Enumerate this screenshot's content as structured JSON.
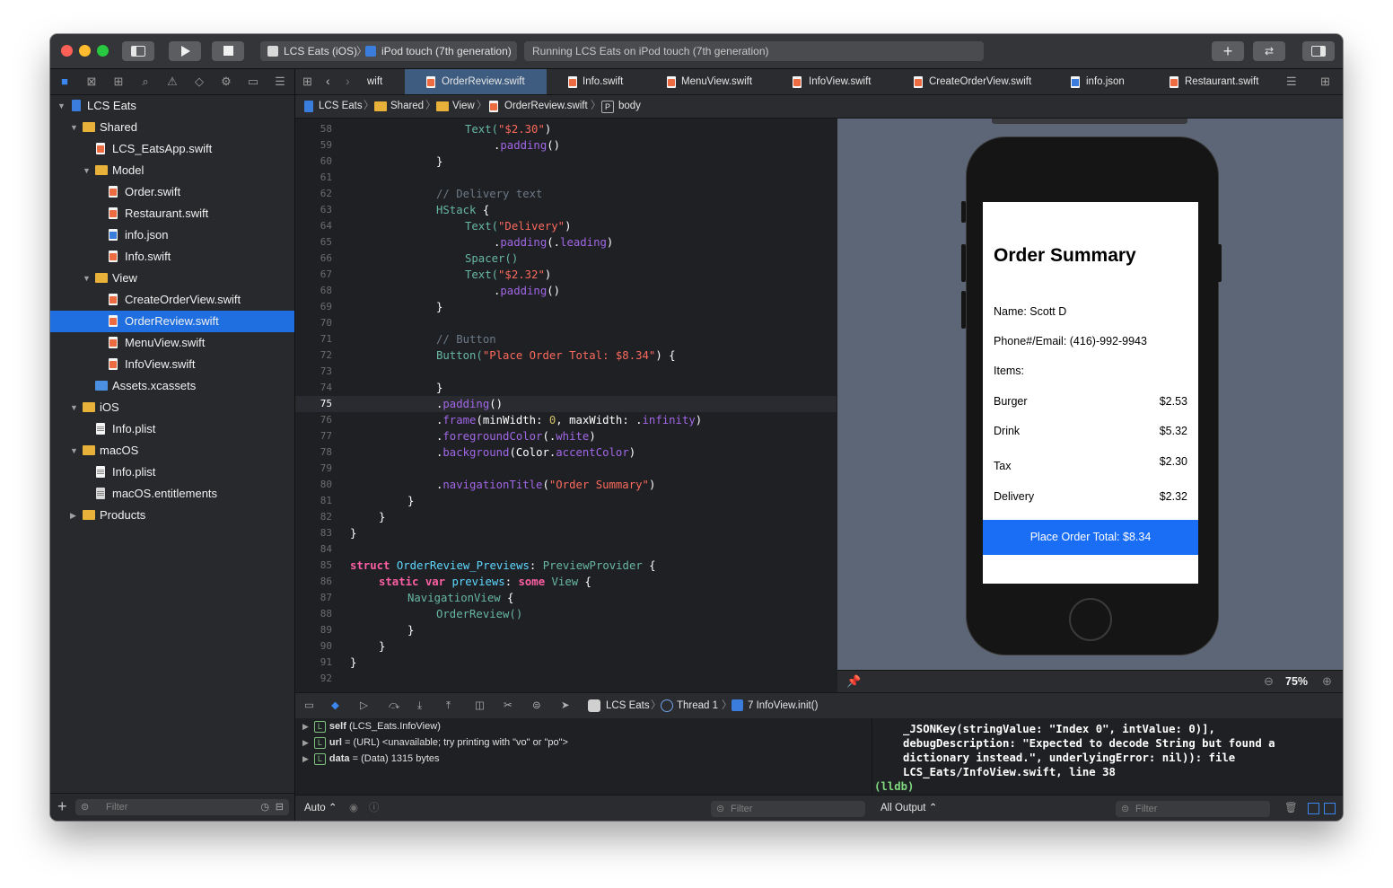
{
  "toolbar": {
    "scheme": "LCS Eats (iOS)",
    "destination": "iPod touch (7th generation)",
    "activity": "Running LCS Eats on iPod touch (7th generation)"
  },
  "navigator": {
    "items": [
      {
        "label": "LCS Eats"
      },
      {
        "label": "Shared"
      },
      {
        "label": "LCS_EatsApp.swift"
      },
      {
        "label": "Model"
      },
      {
        "label": "Order.swift"
      },
      {
        "label": "Restaurant.swift"
      },
      {
        "label": "info.json"
      },
      {
        "label": "Info.swift"
      },
      {
        "label": "View"
      },
      {
        "label": "CreateOrderView.swift"
      },
      {
        "label": "OrderReview.swift"
      },
      {
        "label": "MenuView.swift"
      },
      {
        "label": "InfoView.swift"
      },
      {
        "label": "Assets.xcassets"
      },
      {
        "label": "iOS"
      },
      {
        "label": "Info.plist"
      },
      {
        "label": "macOS"
      },
      {
        "label": "Info.plist"
      },
      {
        "label": "macOS.entitlements"
      },
      {
        "label": "Products"
      }
    ],
    "filter_placeholder": "Filter"
  },
  "tabs": [
    {
      "label": "wift"
    },
    {
      "label": "OrderReview.swift"
    },
    {
      "label": "Info.swift"
    },
    {
      "label": "MenuView.swift"
    },
    {
      "label": "InfoView.swift"
    },
    {
      "label": "CreateOrderView.swift"
    },
    {
      "label": "info.json"
    },
    {
      "label": "Restaurant.swift"
    }
  ],
  "jumpbar": [
    "LCS Eats",
    "Shared",
    "View",
    "OrderReview.swift",
    "body"
  ],
  "code": {
    "line_numbers": [
      "58",
      "59",
      "60",
      "61",
      "62",
      "63",
      "64",
      "65",
      "66",
      "67",
      "68",
      "69",
      "70",
      "71",
      "72",
      "73",
      "74",
      "75",
      "76",
      "77",
      "78",
      "79",
      "80",
      "81",
      "82",
      "83",
      "84",
      "85",
      "86",
      "87",
      "88",
      "89",
      "90",
      "91",
      "92"
    ],
    "current_line": "75",
    "tokens": {
      "l58a": "Text(",
      "l58b": "\"$2.30\"",
      "l58c": ")",
      "l59a": ".",
      "l59b": "padding",
      "l59c": "()",
      "l60": "}",
      "l62": "// Delivery text",
      "l63a": "HStack",
      "l63b": " {",
      "l64a": "Text(",
      "l64b": "\"Delivery\"",
      "l64c": ")",
      "l65a": ".",
      "l65b": "padding",
      "l65c": "(.",
      "l65d": "leading",
      "l65e": ")",
      "l66": "Spacer()",
      "l67a": "Text(",
      "l67b": "\"$2.32\"",
      "l67c": ")",
      "l68a": ".",
      "l68b": "padding",
      "l68c": "()",
      "l69": "}",
      "l71": "// Button",
      "l72a": "Button(",
      "l72b": "\"Place Order Total: $8.34\"",
      "l72c": ") {",
      "l74": "}",
      "l75a": ".",
      "l75b": "padding",
      "l75c": "()",
      "l76a": ".",
      "l76b": "frame",
      "l76c": "(minWidth: ",
      "l76d": "0",
      "l76e": ", maxWidth: .",
      "l76f": "infinity",
      "l76g": ")",
      "l77a": ".",
      "l77b": "foregroundColor",
      "l77c": "(.",
      "l77d": "white",
      "l77e": ")",
      "l78a": ".",
      "l78b": "background",
      "l78c": "(Color.",
      "l78d": "accentColor",
      "l78e": ")",
      "l80a": ".",
      "l80b": "navigationTitle",
      "l80c": "(",
      "l80d": "\"Order Summary\"",
      "l80e": ")",
      "l81": "}",
      "l82": "}",
      "l83": "}",
      "l85a": "struct",
      "l85b": " OrderReview_Previews",
      "l85c": ": ",
      "l85d": "PreviewProvider",
      "l85e": " {",
      "l86a": "static",
      "l86b": " var",
      "l86c": " previews",
      "l86d": ": ",
      "l86e": "some",
      "l86f": " View",
      "l86g": " {",
      "l87a": "NavigationView",
      "l87b": " {",
      "l88": "OrderReview()",
      "l89": "}",
      "l90": "}",
      "l91": "}"
    }
  },
  "preview": {
    "title": "Order Summary",
    "name": "Name: Scott D",
    "contact": "Phone#/Email: (416)-992-9943",
    "items_label": "Items:",
    "rows": [
      {
        "label": "Burger",
        "value": "$2.53"
      },
      {
        "label": "Drink",
        "value": "$5.32"
      },
      {
        "label": "Tax",
        "value": "$2.30"
      },
      {
        "label": "Delivery",
        "value": "$2.32"
      }
    ],
    "button": "Place Order Total: $8.34",
    "zoom": "75%"
  },
  "debug": {
    "breadcrumb": [
      "LCS Eats",
      "Thread 1",
      "7 InfoView.init()"
    ],
    "variables": [
      {
        "name": "self",
        "detail": "(LCS_Eats.InfoView)"
      },
      {
        "name": "url",
        "detail": "= (URL) <unavailable; try printing with \"vo\" or \"po\">"
      },
      {
        "name": "data",
        "detail": "= (Data) 1315 bytes"
      }
    ],
    "console_lines": [
      "_JSONKey(stringValue: \"Index 0\", intValue: 0)],",
      "debugDescription: \"Expected to decode String but found a",
      "dictionary instead.\", underlyingError: nil)): file",
      "LCS_Eats/InfoView.swift, line 38"
    ],
    "prompt": "(lldb)",
    "var_mode": "Auto",
    "output_mode": "All Output",
    "filter_placeholder": "Filter"
  }
}
